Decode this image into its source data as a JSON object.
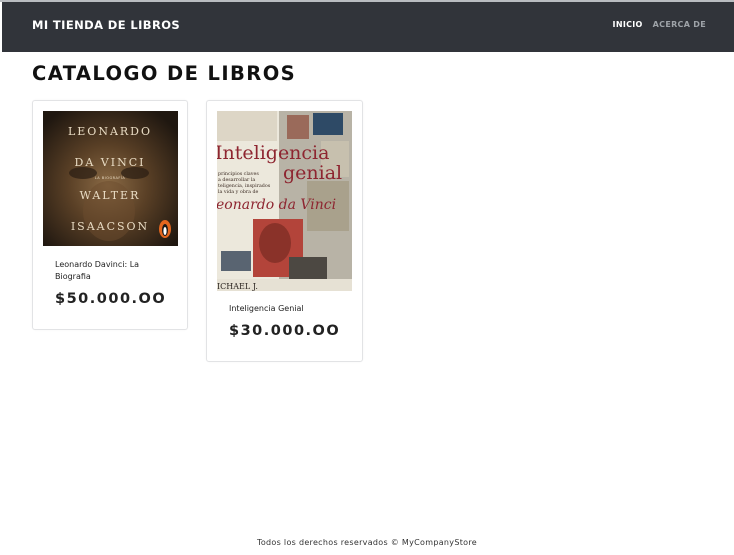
{
  "colors": {
    "navbar": "#31343a",
    "page_bg": "#ffffff",
    "nav_active": "#ffffff",
    "nav_inactive": "#9ea3a8"
  },
  "navbar": {
    "brand": "MI TIENDA DE LIBROS",
    "links": [
      {
        "label": "INICIO",
        "active": true
      },
      {
        "label": "ACERCA DE",
        "active": false
      }
    ]
  },
  "page": {
    "title": "CATALOGO DE LIBROS"
  },
  "books": [
    {
      "title": "Leonardo Davinci: La Biografia",
      "price": "$50.000.OO",
      "cover": {
        "lines": [
          "LEONARDO",
          "DA VINCI",
          "LA BIOGRAFÍA",
          "WALTER",
          "ISAACSON"
        ]
      }
    },
    {
      "title": "Inteligencia Genial",
      "price": "$30.000.OO",
      "cover": {
        "lines": [
          "Inteligencia",
          "genial",
          "principios claves",
          "a desarrollar la",
          "teligencia, inspirados",
          "la vida y obra de",
          "eonardo da Vinci",
          "ICHAEL J."
        ]
      }
    }
  ],
  "footer": {
    "text": "Todos los derechos reservados © MyCompanyStore"
  }
}
